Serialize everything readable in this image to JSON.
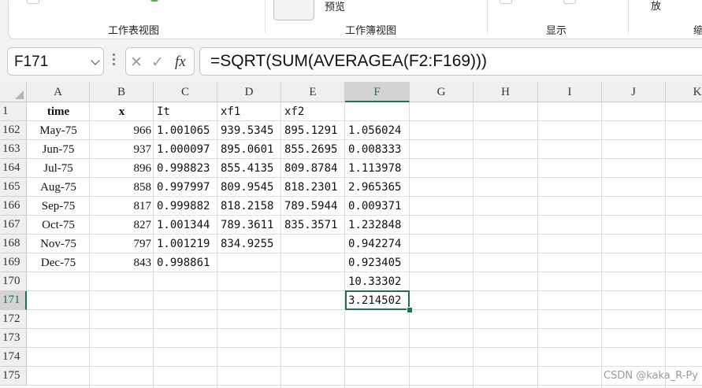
{
  "ribbon": {
    "groups": [
      "工作表视图",
      "工作簿视图",
      "显示",
      "缩"
    ],
    "preview_label": "预览",
    "zoom_label": "放"
  },
  "formula_bar": {
    "name_box": "F171",
    "fx_symbol": "fx",
    "formula": "=SQRT(SUM(AVERAGEA(F2:F169)))"
  },
  "columns": [
    "A",
    "B",
    "C",
    "D",
    "E",
    "F",
    "G",
    "H",
    "I",
    "J",
    "K"
  ],
  "selected_column": "F",
  "selected_row": "171",
  "header_row": {
    "row": "1",
    "cells": [
      "time",
      "x",
      "It",
      "xf1",
      "xf2",
      "",
      "",
      "",
      "",
      "",
      ""
    ]
  },
  "rows": [
    {
      "row": "162",
      "time": "May-75",
      "x": "966",
      "It": "1.001065",
      "xf1": "939.5345",
      "xf2": "895.1291",
      "F": "1.056024"
    },
    {
      "row": "163",
      "time": "Jun-75",
      "x": "937",
      "It": "1.000097",
      "xf1": "895.0601",
      "xf2": "855.2695",
      "F": "0.008333"
    },
    {
      "row": "164",
      "time": "Jul-75",
      "x": "896",
      "It": "0.998823",
      "xf1": "855.4135",
      "xf2": "809.8784",
      "F": "1.113978"
    },
    {
      "row": "165",
      "time": "Aug-75",
      "x": "858",
      "It": "0.997997",
      "xf1": "809.9545",
      "xf2": "818.2301",
      "F": "2.965365"
    },
    {
      "row": "166",
      "time": "Sep-75",
      "x": "817",
      "It": "0.999882",
      "xf1": "818.2158",
      "xf2": "789.5944",
      "F": "0.009371"
    },
    {
      "row": "167",
      "time": "Oct-75",
      "x": "827",
      "It": "1.001344",
      "xf1": "789.3611",
      "xf2": "835.3571",
      "F": "1.232848"
    },
    {
      "row": "168",
      "time": "Nov-75",
      "x": "797",
      "It": "1.001219",
      "xf1": "834.9255",
      "xf2": "",
      "F": "0.942274"
    },
    {
      "row": "169",
      "time": "Dec-75",
      "x": "843",
      "It": "0.998861",
      "xf1": "",
      "xf2": "",
      "F": "0.923405"
    },
    {
      "row": "170",
      "time": "",
      "x": "",
      "It": "",
      "xf1": "",
      "xf2": "",
      "F": "10.33302"
    },
    {
      "row": "171",
      "time": "",
      "x": "",
      "It": "",
      "xf1": "",
      "xf2": "",
      "F": "3.214502"
    },
    {
      "row": "172",
      "time": "",
      "x": "",
      "It": "",
      "xf1": "",
      "xf2": "",
      "F": ""
    },
    {
      "row": "173",
      "time": "",
      "x": "",
      "It": "",
      "xf1": "",
      "xf2": "",
      "F": ""
    },
    {
      "row": "174",
      "time": "",
      "x": "",
      "It": "",
      "xf1": "",
      "xf2": "",
      "F": ""
    },
    {
      "row": "175",
      "time": "",
      "x": "",
      "It": "",
      "xf1": "",
      "xf2": "",
      "F": ""
    }
  ],
  "watermark": "CSDN @kaka_R-Py",
  "accent_color": "#217346"
}
